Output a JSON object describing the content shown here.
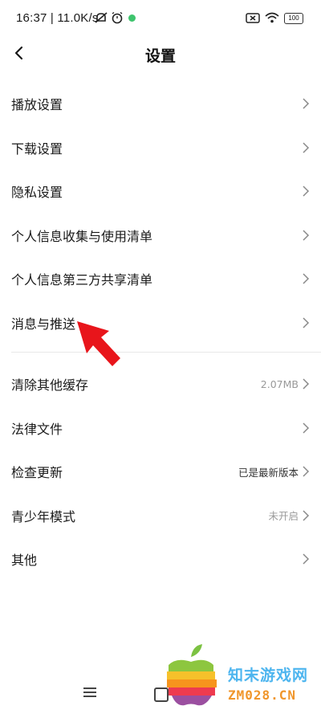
{
  "status_bar": {
    "time_speed": "16:37 | 11.0K/s",
    "battery": "100"
  },
  "header": {
    "title": "设置"
  },
  "items": [
    {
      "label": "播放设置",
      "value": "",
      "value_style": ""
    },
    {
      "label": "下载设置",
      "value": "",
      "value_style": ""
    },
    {
      "label": "隐私设置",
      "value": "",
      "value_style": ""
    },
    {
      "label": "个人信息收集与使用清单",
      "value": "",
      "value_style": ""
    },
    {
      "label": "个人信息第三方共享清单",
      "value": "",
      "value_style": ""
    },
    {
      "label": "消息与推送",
      "value": "",
      "value_style": ""
    },
    {
      "label": "清除其他缓存",
      "value": "2.07MB",
      "value_style": "muted"
    },
    {
      "label": "法律文件",
      "value": "",
      "value_style": ""
    },
    {
      "label": "检查更新",
      "value": "已是最新版本",
      "value_style": "dark"
    },
    {
      "label": "青少年模式",
      "value": "未开启",
      "value_style": "muted"
    },
    {
      "label": "其他",
      "value": "",
      "value_style": ""
    }
  ],
  "watermark": {
    "site_name": "知末游戏网",
    "site_url": "ZM028.CN"
  },
  "colors": {
    "annotation_arrow": "#e8151b",
    "watermark_blue": "#4db5ef",
    "watermark_orange": "#f0962b"
  }
}
